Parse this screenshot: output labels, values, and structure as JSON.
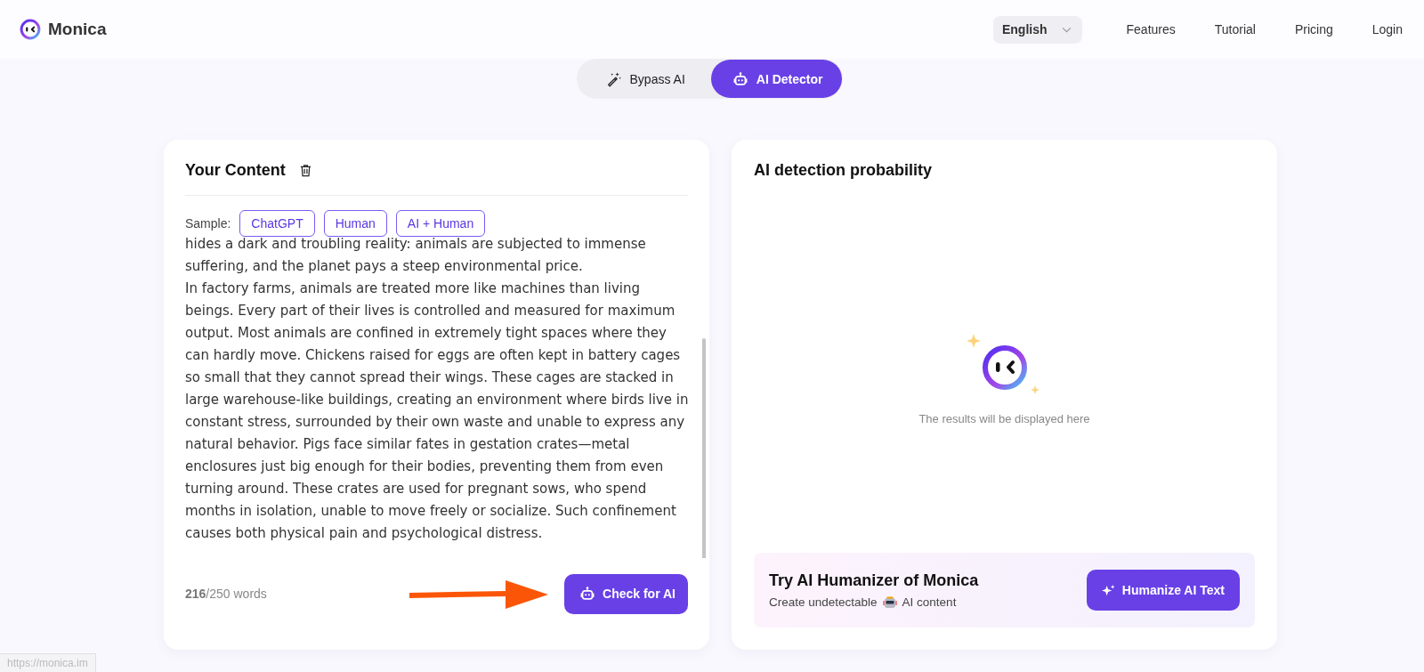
{
  "header": {
    "brand": "Monica",
    "language": {
      "label": "English"
    },
    "nav": [
      {
        "label": "Features"
      },
      {
        "label": "Tutorial"
      },
      {
        "label": "Pricing"
      },
      {
        "label": "Login"
      }
    ]
  },
  "mode_tabs": [
    {
      "label": "Bypass AI",
      "selected": false
    },
    {
      "label": "AI Detector",
      "selected": true
    }
  ],
  "input_panel": {
    "title": "Your Content",
    "sample_label": "Sample:",
    "samples": [
      {
        "label": "ChatGPT"
      },
      {
        "label": "Human"
      },
      {
        "label": "AI + Human"
      }
    ],
    "paragraphs": [
      "hides a dark and troubling reality: animals are subjected to immense suffering, and the planet pays a steep environmental price.",
      "In factory farms, animals are treated more like machines than living beings. Every part of their lives is controlled and measured for maximum output. Most animals are confined in extremely tight spaces where they can hardly move. Chickens raised for eggs are often kept in battery cages so small that they cannot spread their wings. These cages are stacked in large warehouse-like buildings, creating an environment where birds live in constant stress, surrounded by their own waste and unable to express any natural behavior. Pigs face similar fates in gestation crates—metal enclosures just big enough for their bodies, preventing them from even turning around. These crates are used for pregnant sows, who spend months in isolation, unable to move freely or socialize. Such confinement causes both physical pain and psychological distress."
    ],
    "word_count": "216",
    "word_limit": "/250 words",
    "check_button": "Check for AI"
  },
  "result_panel": {
    "title": "AI detection probability",
    "empty_text": "The results will be displayed here",
    "promo": {
      "title": "Try AI Humanizer of Monica",
      "text_before": "Create undetectable",
      "text_after": "AI content",
      "button": "Humanize AI Text"
    }
  },
  "status_url": "https://monica.im"
}
